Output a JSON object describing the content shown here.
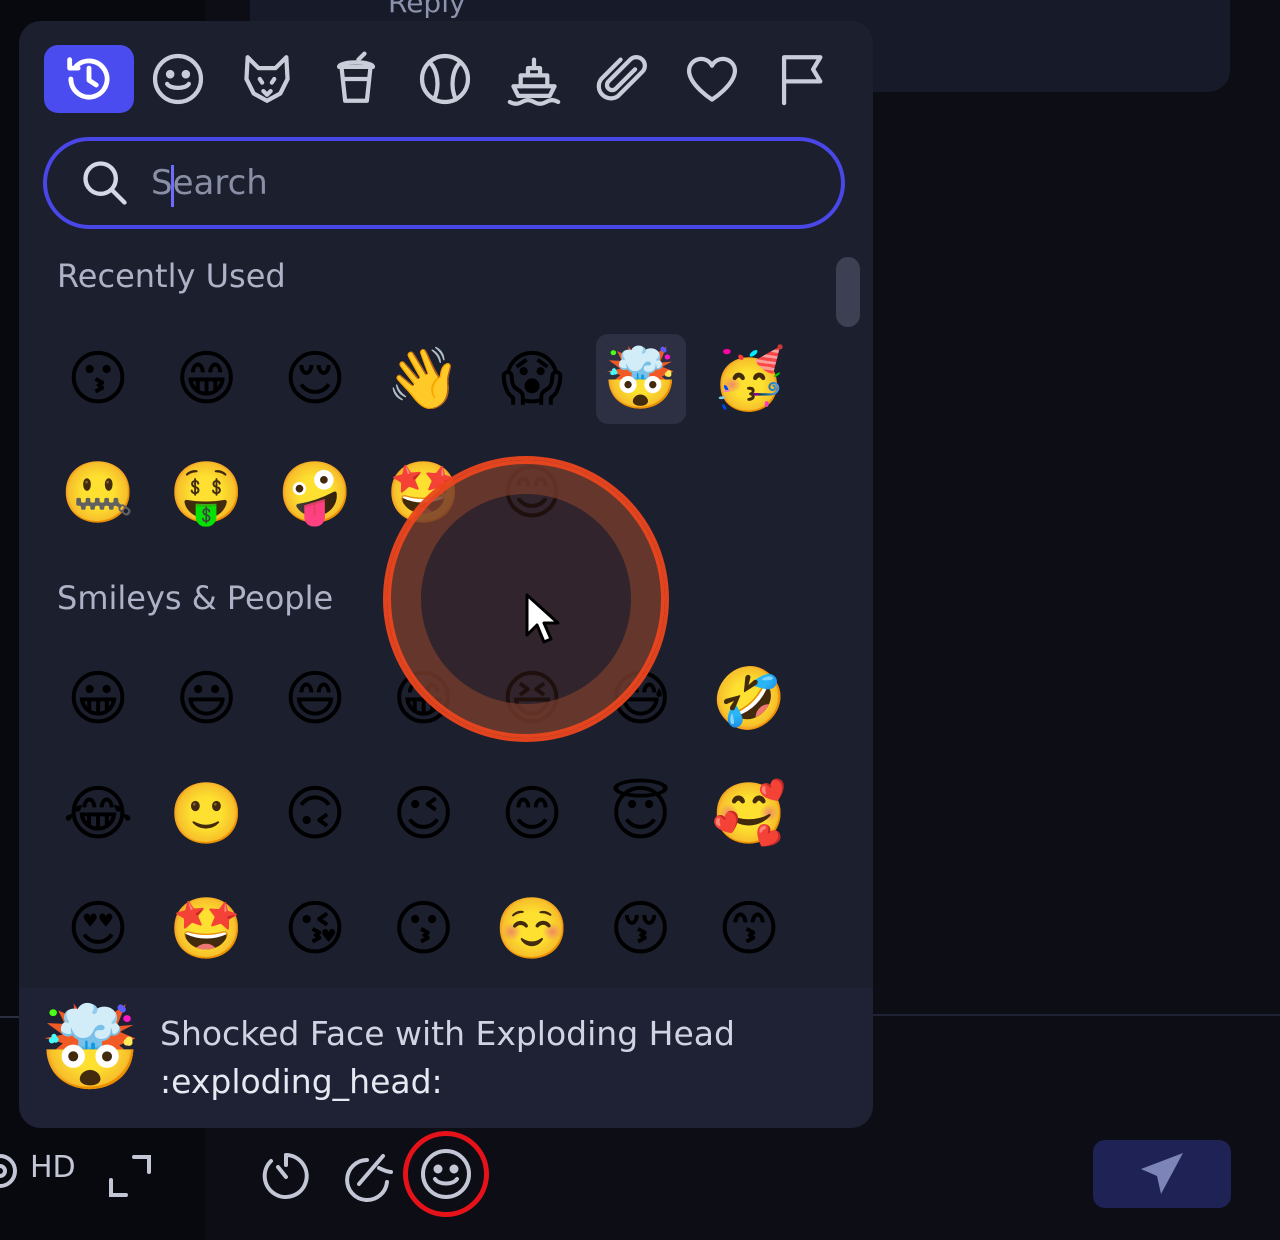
{
  "background": {
    "reply_label": "Reply"
  },
  "picker": {
    "tabs": [
      {
        "name": "recent",
        "icon": "clock-history-icon",
        "active": true
      },
      {
        "name": "smileys",
        "icon": "smiley-icon"
      },
      {
        "name": "animals",
        "icon": "fox-icon"
      },
      {
        "name": "food",
        "icon": "cup-icon"
      },
      {
        "name": "activities",
        "icon": "ball-icon"
      },
      {
        "name": "travel",
        "icon": "ship-icon"
      },
      {
        "name": "objects",
        "icon": "paperclip-icon"
      },
      {
        "name": "symbols",
        "icon": "heart-icon"
      },
      {
        "name": "flags",
        "icon": "flag-icon"
      }
    ],
    "search": {
      "placeholder": "Search",
      "value": ""
    },
    "sections": [
      {
        "title": "Recently Used",
        "emojis": [
          "😗",
          "😁",
          "😌",
          "👋",
          "😱",
          "🤯",
          "🥳",
          "🤐",
          "🤑",
          "🤪",
          "🤩",
          "😊"
        ]
      },
      {
        "title": "Smileys & People",
        "emojis": [
          "😀",
          "😃",
          "😄",
          "😁",
          "😆",
          "😅",
          "🤣",
          "😂",
          "🙂",
          "🙃",
          "😉",
          "😊",
          "😇",
          "🥰",
          "😍",
          "🤩",
          "😘",
          "😗",
          "☺️",
          "😚",
          "😙"
        ]
      }
    ],
    "hovered_emoji": "🤯",
    "preview": {
      "emoji": "🤯",
      "name": "Shocked Face with Exploding Head",
      "shortcode": ":exploding_head:"
    }
  },
  "toolbar": {
    "hd_label": "HD",
    "items": [
      "settings-icon",
      "fullscreen-icon",
      "timer-icon",
      "magic-icon",
      "emoji-button-icon",
      "send-icon"
    ]
  },
  "colors": {
    "accent": "#4b4cf0",
    "picker_bg": "#1c1f2e",
    "highlight": "#e5121a"
  }
}
